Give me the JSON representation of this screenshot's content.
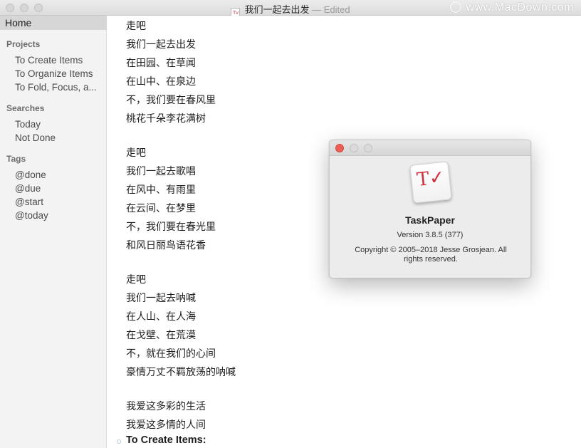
{
  "window": {
    "title": "我们一起去出发",
    "status": "— Edited",
    "doc_icon": "Tv",
    "watermark": "www.MacDown.com"
  },
  "sidebar": {
    "home": "Home",
    "projects_header": "Projects",
    "projects": [
      "To Create Items",
      "To Organize Items",
      "To Fold, Focus, a..."
    ],
    "searches_header": "Searches",
    "searches": [
      "Today",
      "Not Done"
    ],
    "tags_header": "Tags",
    "tags": [
      "@done",
      "@due",
      "@start",
      "@today"
    ]
  },
  "editor": {
    "lines": [
      "走吧",
      "我们一起去出发",
      "在田园、在草闻",
      "在山中、在泉边",
      "不，我们要在春风里",
      "桃花千朵李花满树",
      "走吧",
      "我们一起去歌唱",
      "在风中、有雨里",
      "在云间、在梦里",
      "不，我们要在春光里",
      "和风日丽鸟语花香",
      "走吧",
      "我们一起去呐喊",
      "在人山、在人海",
      "在戈壁、在荒漠",
      "不，就在我们的心间",
      "豪情万丈不羁放荡的呐喊",
      "我爱这多彩的生活",
      "我爱这多情的人间"
    ],
    "project_heading": "To Create Items:"
  },
  "about": {
    "app_name": "TaskPaper",
    "version": "Version 3.8.5 (377)",
    "copyright": "Copyright © 2005–2018 Jesse Grosjean. All rights reserved.",
    "icon_mark": "T✓",
    "close_color": "#ec5f57"
  }
}
